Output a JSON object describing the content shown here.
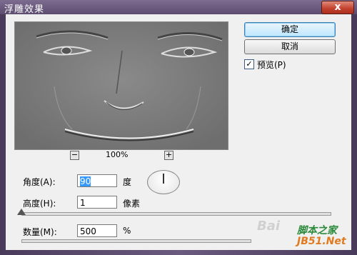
{
  "dialog": {
    "title": "浮雕效果",
    "close_label": "x"
  },
  "preview": {
    "zoom_label": "100%",
    "zoom_minus": "−",
    "zoom_plus": "+"
  },
  "buttons": {
    "ok": "确定",
    "cancel": "取消"
  },
  "preview_toggle": {
    "label": "预览(P)",
    "checked": true,
    "check_glyph": "✓"
  },
  "fields": {
    "angle": {
      "label": "角度(A):",
      "value": "90",
      "unit": "度"
    },
    "height": {
      "label": "高度(H):",
      "value": "1",
      "unit": "像素",
      "slider_fraction": 0.01
    },
    "amount": {
      "label": "数量(M):",
      "value": "500",
      "unit": "%"
    }
  },
  "watermark": {
    "baidu": "Bai",
    "site_cn": "脚本之家",
    "site_url": "JB51.Net"
  },
  "colors": {
    "accent": "#3399ff",
    "title_bar": "#6a5a7e",
    "close": "#c2402c"
  }
}
